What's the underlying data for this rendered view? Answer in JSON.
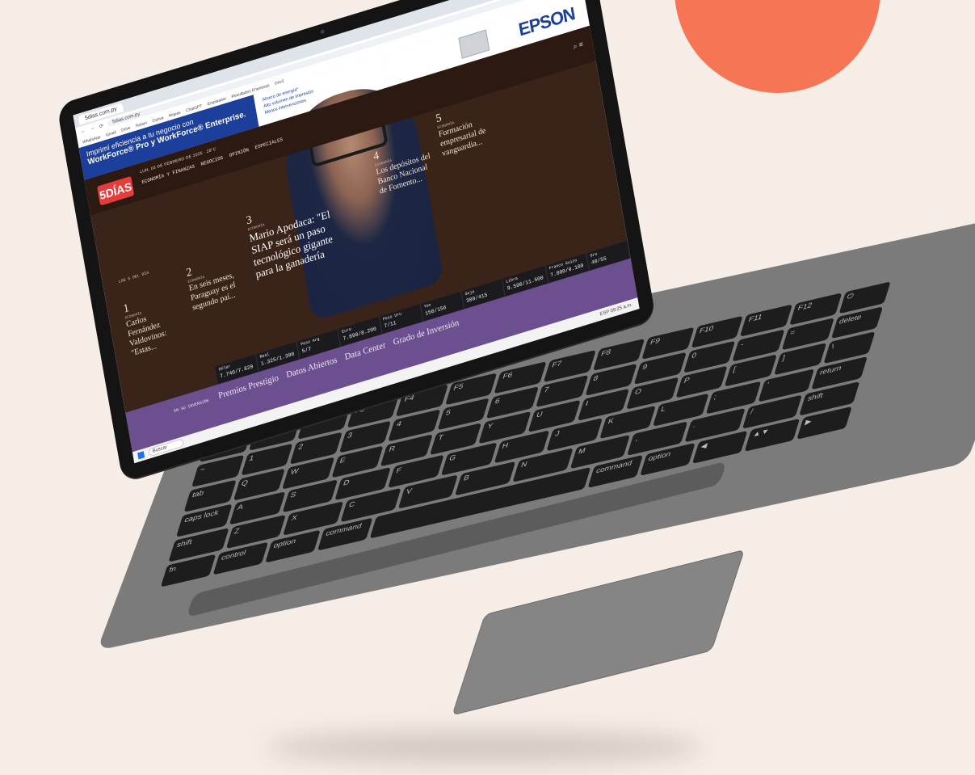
{
  "browser": {
    "tab_title": "5dias.com.py",
    "url": "5dias.com.py",
    "bookmarks": [
      "WhatsApp",
      "Gmail",
      "Drive",
      "Notion",
      "Canva",
      "Mapas",
      "ChatGPT",
      "Empleador",
      "Resultados Empresas",
      "Dev3"
    ]
  },
  "ad": {
    "line1": "Imprimí eficiencia a tu negocio con",
    "line2": "WorkForce® Pro y WorkForce® Enterprise.",
    "bullets": [
      "Ahorro de energía*",
      "Alto volumen de impresión",
      "Menos intervenciones"
    ],
    "brand": "EPSON"
  },
  "site": {
    "logo": "5DÍAS",
    "date": "LUN, 03 DE FEBRERO DE 2025 · 28°C",
    "nav": [
      "ECONOMÍA Y FINANZAS",
      "NEGOCIOS",
      "OPINIÓN",
      "ESPECIALES"
    ],
    "top_label": "LOS 5 DEL DÍA",
    "stories": [
      {
        "num": "1",
        "cat": "ECONOMÍA",
        "title": "Carlos Fernández Valdovinos: \"Estas..."
      },
      {
        "num": "2",
        "cat": "ECONOMÍA",
        "title": "En seis meses, Paraguay es el segundo paí..."
      },
      {
        "num": "3",
        "cat": "ECONOMÍA",
        "title": "Mario Apodaca: \"El SIAP será un paso tecnológico gigante para la ganadería"
      },
      {
        "num": "4",
        "cat": "ECONOMÍA",
        "title": "Los depósitos del Banco Nacional de Fomento..."
      },
      {
        "num": "5",
        "cat": "ECONOMÍA",
        "title": "Formación empresarial de vanguardia..."
      }
    ],
    "ticker": [
      {
        "label": "Dólar",
        "value": "7.740/7.820"
      },
      {
        "label": "Real",
        "value": "1.325/1.390"
      },
      {
        "label": "Peso Arg",
        "value": "5/7"
      },
      {
        "label": "Euro",
        "value": "7.890/8.200"
      },
      {
        "label": "Peso Uru",
        "value": "7/11"
      },
      {
        "label": "Yen",
        "value": "150/156"
      },
      {
        "label": "Soja",
        "value": "300/415"
      },
      {
        "label": "Libra",
        "value": "9.590/11.500"
      },
      {
        "label": "Franco Suizo",
        "value": "7.800/9.100"
      },
      {
        "label": "Oro",
        "value": "40/55"
      }
    ],
    "links_label": "EN SU INVERSIÓN",
    "links": [
      "Premios Prestigio",
      "Datos Abiertos",
      "Data Center",
      "Grado de Inversión"
    ]
  },
  "taskbar": {
    "search_placeholder": "Buscar",
    "clock": "09:25 a.m.",
    "lang": "ESP"
  },
  "keyboard": {
    "rows": [
      [
        "esc",
        "F1",
        "F2",
        "F3",
        "F4",
        "F5",
        "F6",
        "F7",
        "F8",
        "F9",
        "F10",
        "F11",
        "F12",
        "⏻"
      ],
      [
        "~",
        "1",
        "2",
        "3",
        "4",
        "5",
        "6",
        "7",
        "8",
        "9",
        "0",
        "-",
        "=",
        "delete"
      ],
      [
        "tab",
        "Q",
        "W",
        "E",
        "R",
        "T",
        "Y",
        "U",
        "I",
        "O",
        "P",
        "[",
        "]",
        "\\"
      ],
      [
        "caps lock",
        "A",
        "S",
        "D",
        "F",
        "G",
        "H",
        "J",
        "K",
        "L",
        ";",
        "'",
        "return"
      ],
      [
        "shift",
        "Z",
        "X",
        "C",
        "V",
        "B",
        "N",
        "M",
        ",",
        ".",
        "/",
        "shift"
      ],
      [
        "fn",
        "control",
        "option",
        "command",
        "",
        "command",
        "option",
        "◀",
        "▲▼",
        "▶"
      ]
    ]
  }
}
